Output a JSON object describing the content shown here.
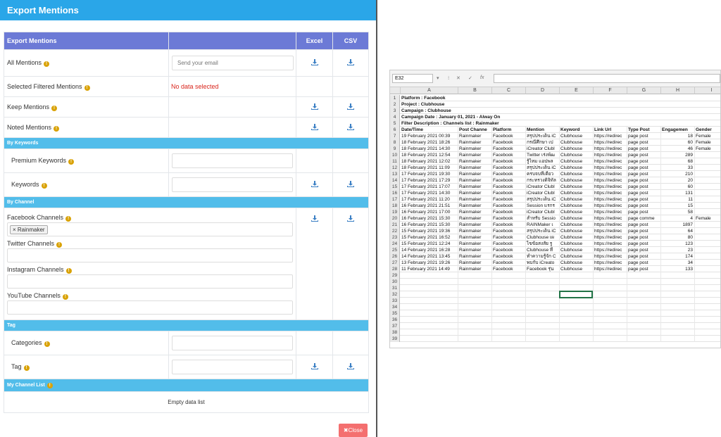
{
  "modal": {
    "title": "Export Mentions",
    "table_headers": [
      "Export Mentions",
      "",
      "Excel",
      "CSV"
    ],
    "rows": {
      "all_mentions": {
        "label": "All Mentions",
        "placeholder": "Send your email"
      },
      "selected_filtered": {
        "label": "Selected Filtered Mentions",
        "status": "No data selected"
      },
      "keep": {
        "label": "Keep Mentions"
      },
      "noted": {
        "label": "Noted Mentions"
      }
    },
    "sections": {
      "by_keywords": "By Keywords",
      "by_channel": "By Channel",
      "tag": "Tag",
      "my_channel_list": "My Channel List"
    },
    "keywords": {
      "premium": "Premium Keywords",
      "keywords": "Keywords"
    },
    "channels": {
      "facebook": "Facebook Channels",
      "facebook_chip": "Rainmaker",
      "twitter": "Twitter Channels",
      "instagram": "Instagram Channels",
      "youtube": "YouTube Channels"
    },
    "tag": {
      "categories": "Categories",
      "tag": "Tag"
    },
    "empty_list": "Empty data list",
    "close_label": "Close",
    "colors": {
      "header": "#2aa6e8",
      "table_head": "#6c7ad6",
      "section": "#52bdea",
      "download": "#3b7fc4",
      "info": "#d9a206",
      "close": "#f46f6f"
    }
  },
  "sheet": {
    "name_box": "E32",
    "columns": [
      "A",
      "B",
      "C",
      "D",
      "E",
      "F",
      "G",
      "H",
      "I"
    ],
    "meta_rows": [
      "Platform : Facebook",
      "Project : Clubhouse",
      "Campaign : Clubhouse",
      "Campaign Date : January 01, 2021 - Alway On",
      "Filter Description : Channels list : Rainmaker"
    ],
    "headers": [
      "Date/Time",
      "Post Channe",
      "Platform",
      "Mention",
      "Keyword",
      "Link Url",
      "Type Post",
      "Engagemen",
      "Gender"
    ],
    "data_rows": [
      [
        "19 February 2021 00:39",
        "Rainmaker",
        "Facebook",
        "สรุปประเด็น iC",
        "Clubhouse",
        "https://redirec",
        "page post",
        "18",
        "Female"
      ],
      [
        "18 February 2021 18:26",
        "Rainmaker",
        "Facebook",
        "กรณีศึกษา เป",
        "Clubhouse",
        "https://redirec",
        "page post",
        "60",
        "Female"
      ],
      [
        "18 February 2021 14:30",
        "Rainmaker",
        "Facebook",
        "iCreator Clubl",
        "Clubhouse",
        "https://redirec",
        "page post",
        "46",
        "Female"
      ],
      [
        "18 February 2021 12:54",
        "Rainmaker",
        "Facebook",
        "Twitter เร่งพัฒ",
        "Clubhouse",
        "https://redirec",
        "page post",
        "289",
        ""
      ],
      [
        "18 February 2021 12:02",
        "Rainmaker",
        "Facebook",
        "รู้ไหม แอปพล",
        "Clubhouse",
        "https://redirec",
        "page post",
        "68",
        ""
      ],
      [
        "18 February 2021 11:09",
        "Rainmaker",
        "Facebook",
        "สรุปประเด็น iC",
        "Clubhouse",
        "https://redirec",
        "page post",
        "33",
        ""
      ],
      [
        "17 February 2021 19:30",
        "Rainmaker",
        "Facebook",
        "ครบจบที่เดียว",
        "Clubhouse",
        "https://redirec",
        "page post",
        "210",
        ""
      ],
      [
        "17 February 2021 17:29",
        "Rainmaker",
        "Facebook",
        "กระทรวงดิจิทัล",
        "Clubhouse",
        "https://redirec",
        "page post",
        "20",
        ""
      ],
      [
        "17 February 2021 17:07",
        "Rainmaker",
        "Facebook",
        "iCreator Clubl",
        "Clubhouse",
        "https://redirec",
        "page post",
        "60",
        ""
      ],
      [
        "17 February 2021 14:30",
        "Rainmaker",
        "Facebook",
        "iCreator Clubl",
        "Clubhouse",
        "https://redirec",
        "page post",
        "131",
        ""
      ],
      [
        "17 February 2021 11:20",
        "Rainmaker",
        "Facebook",
        "สรุปประเด็น iC",
        "Clubhouse",
        "https://redirec",
        "page post",
        "11",
        ""
      ],
      [
        "16 February 2021 21:51",
        "Rainmaker",
        "Facebook",
        "Session แรกร",
        "Clubhouse",
        "https://redirec",
        "page post",
        "15",
        ""
      ],
      [
        "16 February 2021 17:00",
        "Rainmaker",
        "Facebook",
        "iCreator Clubl",
        "Clubhouse",
        "https://redirec",
        "page post",
        "58",
        ""
      ],
      [
        "16 February 2021 15:30",
        "Rainmaker",
        "Facebook",
        "สำหรับ Sessio",
        "Clubhouse",
        "https://redirec",
        "page comme",
        "4",
        "Female"
      ],
      [
        "16 February 2021 15:30",
        "Rainmaker",
        "Facebook",
        "RAINMaker เ",
        "Clubhouse",
        "https://redirec",
        "page post",
        "1897",
        ""
      ],
      [
        "15 February 2021 19:36",
        "Rainmaker",
        "Facebook",
        "สรุปประเด็น iC",
        "Clubhouse",
        "https://redirec",
        "page post",
        "64",
        ""
      ],
      [
        "15 February 2021 16:52",
        "Rainmaker",
        "Facebook",
        "Clubhouse เผ",
        "Clubhouse",
        "https://redirec",
        "page post",
        "80",
        ""
      ],
      [
        "15 February 2021 12:24",
        "Rainmaker",
        "Facebook",
        "ไขข้อสงสัย รู",
        "Clubhouse",
        "https://redirec",
        "page post",
        "123",
        ""
      ],
      [
        "14 February 2021 16:28",
        "Rainmaker",
        "Facebook",
        "Clubhouse ที่",
        "Clubhouse",
        "https://redirec",
        "page post",
        "23",
        ""
      ],
      [
        "14 February 2021 13:45",
        "Rainmaker",
        "Facebook",
        "ทำความรู้จัก C",
        "Clubhouse",
        "https://redirec",
        "page post",
        "174",
        ""
      ],
      [
        "13 February 2021 19:26",
        "Rainmaker",
        "Facebook",
        "พบกับ iCreato",
        "Clubhouse",
        "https://redirec",
        "page post",
        "34",
        ""
      ],
      [
        "11 February 2021 14:49",
        "Rainmaker",
        "Facebook",
        "Facebook รุ่น",
        "Clubhouse",
        "https://redirec",
        "page post",
        "133",
        ""
      ]
    ],
    "row_numbers": [
      "1",
      "2",
      "3",
      "4",
      "5",
      "6",
      "7",
      "8",
      "9",
      "10",
      "11",
      "12",
      "13",
      "14",
      "15",
      "16",
      "17",
      "18",
      "19",
      "20",
      "21",
      "22",
      "23",
      "24",
      "25",
      "26",
      "27",
      "28",
      "29",
      "30",
      "31",
      "32",
      "33",
      "34",
      "35",
      "36",
      "37",
      "38",
      "39"
    ]
  }
}
